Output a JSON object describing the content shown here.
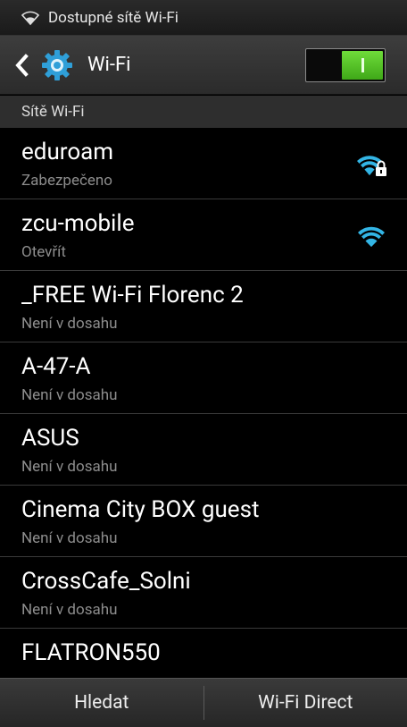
{
  "status_bar": {
    "text": "Dostupné sítě Wi-Fi",
    "icon": "wifi-notification-icon"
  },
  "action_bar": {
    "title": "Wi-Fi",
    "toggle_state": "on",
    "accent": "#4cc62a"
  },
  "section": {
    "title": "Sítě Wi-Fi"
  },
  "networks": [
    {
      "name": "eduroam",
      "status": "Zabezpečeno",
      "signal": "secured-wifi-icon"
    },
    {
      "name": "zcu-mobile",
      "status": "Otevřít",
      "signal": "wifi-icon"
    },
    {
      "name": "_FREE Wi-Fi Florenc  2",
      "status": "Není v dosahu"
    },
    {
      "name": "A-47-A",
      "status": "Není v dosahu"
    },
    {
      "name": "ASUS",
      "status": "Není v dosahu"
    },
    {
      "name": "Cinema City BOX guest",
      "status": "Není v dosahu"
    },
    {
      "name": "CrossCafe_Solni",
      "status": "Není v dosahu"
    },
    {
      "name": "FLATRON550",
      "status": ""
    }
  ],
  "bottom_bar": {
    "scan": "Hledat",
    "wifi_direct": "Wi-Fi Direct"
  },
  "colors": {
    "signal": "#33b5e5",
    "background": "#000000"
  }
}
